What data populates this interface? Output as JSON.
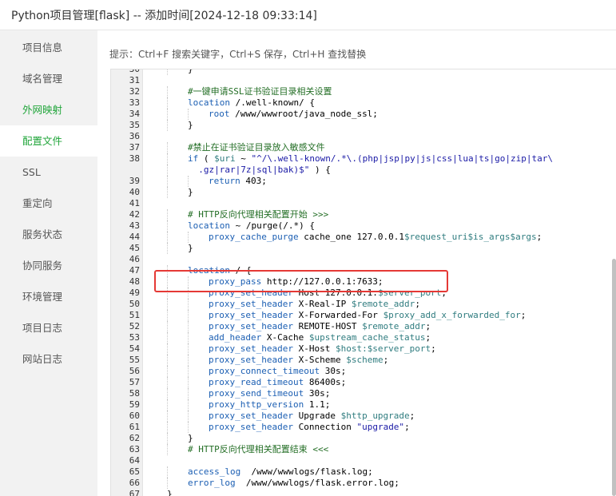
{
  "window": {
    "title": "Python项目管理[flask] -- 添加时间[2024-12-18 09:33:14]"
  },
  "sidebar": {
    "items": [
      {
        "label": "项目信息",
        "state": "normal"
      },
      {
        "label": "域名管理",
        "state": "normal"
      },
      {
        "label": "外网映射",
        "state": "green"
      },
      {
        "label": "配置文件",
        "state": "active"
      },
      {
        "label": "SSL",
        "state": "normal"
      },
      {
        "label": "重定向",
        "state": "normal"
      },
      {
        "label": "服务状态",
        "state": "normal"
      },
      {
        "label": "协同服务",
        "state": "normal"
      },
      {
        "label": "环境管理",
        "state": "normal"
      },
      {
        "label": "项目日志",
        "state": "normal"
      },
      {
        "label": "网站日志",
        "state": "normal"
      }
    ]
  },
  "hint": {
    "text": "提示：Ctrl+F 搜索关键字，Ctrl+S 保存，Ctrl+H 查找替换"
  },
  "colors": {
    "accent": "#20a53a",
    "comment": "#236e25",
    "keyword": "#1c5fb3",
    "variable": "#2f7c7f",
    "string": "#1a1aa6",
    "highlight_box": "#e53935"
  },
  "editor": {
    "lines": [
      {
        "num": "30",
        "indent": 1,
        "tokens": [
          [
            "plain",
            "}"
          ]
        ]
      },
      {
        "num": "31",
        "indent": 0,
        "tokens": []
      },
      {
        "num": "32",
        "indent": 1,
        "tokens": [
          [
            "cm",
            "#一键申请SSL证书验证目录相关设置"
          ]
        ]
      },
      {
        "num": "33",
        "indent": 1,
        "tokens": [
          [
            "kw",
            "location"
          ],
          [
            "plain",
            " /.well-known/ {"
          ]
        ]
      },
      {
        "num": "34",
        "indent": 2,
        "tokens": [
          [
            "kw",
            "root"
          ],
          [
            "plain",
            " /www/wwwroot/java_node_ssl;"
          ]
        ]
      },
      {
        "num": "35",
        "indent": 1,
        "tokens": [
          [
            "plain",
            "}"
          ]
        ]
      },
      {
        "num": "36",
        "indent": 0,
        "tokens": []
      },
      {
        "num": "37",
        "indent": 1,
        "tokens": [
          [
            "cm",
            "#禁止在证书验证目录放入敏感文件"
          ]
        ]
      },
      {
        "num": "38",
        "indent": 1,
        "tokens": [
          [
            "kw",
            "if"
          ],
          [
            "plain",
            " ( "
          ],
          [
            "var",
            "$uri"
          ],
          [
            "plain",
            " ~ "
          ],
          [
            "str",
            "\"^/\\.well-known/.*\\.(php|jsp|py|js|css|lua|ts|go|zip|tar\\"
          ]
        ]
      },
      {
        "num": "",
        "indent": 1,
        "tokens": [
          [
            "str",
            "  .gz|rar|7z|sql|bak)$\""
          ],
          [
            "plain",
            " ) {"
          ]
        ]
      },
      {
        "num": "39",
        "indent": 2,
        "tokens": [
          [
            "kw",
            "return"
          ],
          [
            "plain",
            " 403;"
          ]
        ]
      },
      {
        "num": "40",
        "indent": 1,
        "tokens": [
          [
            "plain",
            "}"
          ]
        ]
      },
      {
        "num": "41",
        "indent": 0,
        "tokens": []
      },
      {
        "num": "42",
        "indent": 1,
        "tokens": [
          [
            "cm",
            "# HTTP反向代理相关配置开始 >>>"
          ]
        ]
      },
      {
        "num": "43",
        "indent": 1,
        "tokens": [
          [
            "kw",
            "location"
          ],
          [
            "plain",
            " ~ /purge(/.*) {"
          ]
        ]
      },
      {
        "num": "44",
        "indent": 2,
        "tokens": [
          [
            "kw",
            "proxy_cache_purge"
          ],
          [
            "plain",
            " cache_one 127.0.0.1"
          ],
          [
            "var",
            "$request_uri$is_args$args"
          ],
          [
            "plain",
            ";"
          ]
        ]
      },
      {
        "num": "45",
        "indent": 1,
        "tokens": [
          [
            "plain",
            "}"
          ]
        ]
      },
      {
        "num": "46",
        "indent": 0,
        "tokens": []
      },
      {
        "num": "47",
        "indent": 1,
        "tokens": [
          [
            "kw",
            "location"
          ],
          [
            "plain",
            " / {"
          ]
        ]
      },
      {
        "num": "48",
        "indent": 2,
        "tokens": [
          [
            "kw",
            "proxy_pass"
          ],
          [
            "plain",
            " http://127.0.0.1:7633;"
          ]
        ]
      },
      {
        "num": "49",
        "indent": 2,
        "tokens": [
          [
            "kw",
            "proxy_set_header"
          ],
          [
            "plain",
            " Host 127.0.0.1:"
          ],
          [
            "var",
            "$server_port"
          ],
          [
            "plain",
            ";"
          ]
        ]
      },
      {
        "num": "50",
        "indent": 2,
        "tokens": [
          [
            "kw",
            "proxy_set_header"
          ],
          [
            "plain",
            " X-Real-IP "
          ],
          [
            "var",
            "$remote_addr"
          ],
          [
            "plain",
            ";"
          ]
        ]
      },
      {
        "num": "51",
        "indent": 2,
        "tokens": [
          [
            "kw",
            "proxy_set_header"
          ],
          [
            "plain",
            " X-Forwarded-For "
          ],
          [
            "var",
            "$proxy_add_x_forwarded_for"
          ],
          [
            "plain",
            ";"
          ]
        ]
      },
      {
        "num": "52",
        "indent": 2,
        "tokens": [
          [
            "kw",
            "proxy_set_header"
          ],
          [
            "plain",
            " REMOTE-HOST "
          ],
          [
            "var",
            "$remote_addr"
          ],
          [
            "plain",
            ";"
          ]
        ]
      },
      {
        "num": "53",
        "indent": 2,
        "tokens": [
          [
            "kw",
            "add_header"
          ],
          [
            "plain",
            " X-Cache "
          ],
          [
            "var",
            "$upstream_cache_status"
          ],
          [
            "plain",
            ";"
          ]
        ]
      },
      {
        "num": "54",
        "indent": 2,
        "tokens": [
          [
            "kw",
            "proxy_set_header"
          ],
          [
            "plain",
            " X-Host "
          ],
          [
            "var",
            "$host:$server_port"
          ],
          [
            "plain",
            ";"
          ]
        ]
      },
      {
        "num": "55",
        "indent": 2,
        "tokens": [
          [
            "kw",
            "proxy_set_header"
          ],
          [
            "plain",
            " X-Scheme "
          ],
          [
            "var",
            "$scheme"
          ],
          [
            "plain",
            ";"
          ]
        ]
      },
      {
        "num": "56",
        "indent": 2,
        "tokens": [
          [
            "kw",
            "proxy_connect_timeout"
          ],
          [
            "plain",
            " 30s;"
          ]
        ]
      },
      {
        "num": "57",
        "indent": 2,
        "tokens": [
          [
            "kw",
            "proxy_read_timeout"
          ],
          [
            "plain",
            " 86400s;"
          ]
        ]
      },
      {
        "num": "58",
        "indent": 2,
        "tokens": [
          [
            "kw",
            "proxy_send_timeout"
          ],
          [
            "plain",
            " 30s;"
          ]
        ]
      },
      {
        "num": "59",
        "indent": 2,
        "tokens": [
          [
            "kw",
            "proxy_http_version"
          ],
          [
            "plain",
            " 1.1;"
          ]
        ]
      },
      {
        "num": "60",
        "indent": 2,
        "tokens": [
          [
            "kw",
            "proxy_set_header"
          ],
          [
            "plain",
            " Upgrade "
          ],
          [
            "var",
            "$http_upgrade"
          ],
          [
            "plain",
            ";"
          ]
        ]
      },
      {
        "num": "61",
        "indent": 2,
        "tokens": [
          [
            "kw",
            "proxy_set_header"
          ],
          [
            "plain",
            " Connection "
          ],
          [
            "str",
            "\"upgrade\""
          ],
          [
            "plain",
            ";"
          ]
        ]
      },
      {
        "num": "62",
        "indent": 1,
        "tokens": [
          [
            "plain",
            "}"
          ]
        ]
      },
      {
        "num": "63",
        "indent": 1,
        "tokens": [
          [
            "cm",
            "# HTTP反向代理相关配置结束 <<<"
          ]
        ]
      },
      {
        "num": "64",
        "indent": 0,
        "tokens": []
      },
      {
        "num": "65",
        "indent": 1,
        "tokens": [
          [
            "kw",
            "access_log"
          ],
          [
            "plain",
            "  /www/wwwlogs/flask.log;"
          ]
        ]
      },
      {
        "num": "66",
        "indent": 1,
        "tokens": [
          [
            "kw",
            "error_log"
          ],
          [
            "plain",
            "  /www/wwwlogs/flask.error.log;"
          ]
        ]
      },
      {
        "num": "67",
        "indent": 0,
        "tokens": [
          [
            "plain",
            "}"
          ]
        ]
      }
    ]
  }
}
